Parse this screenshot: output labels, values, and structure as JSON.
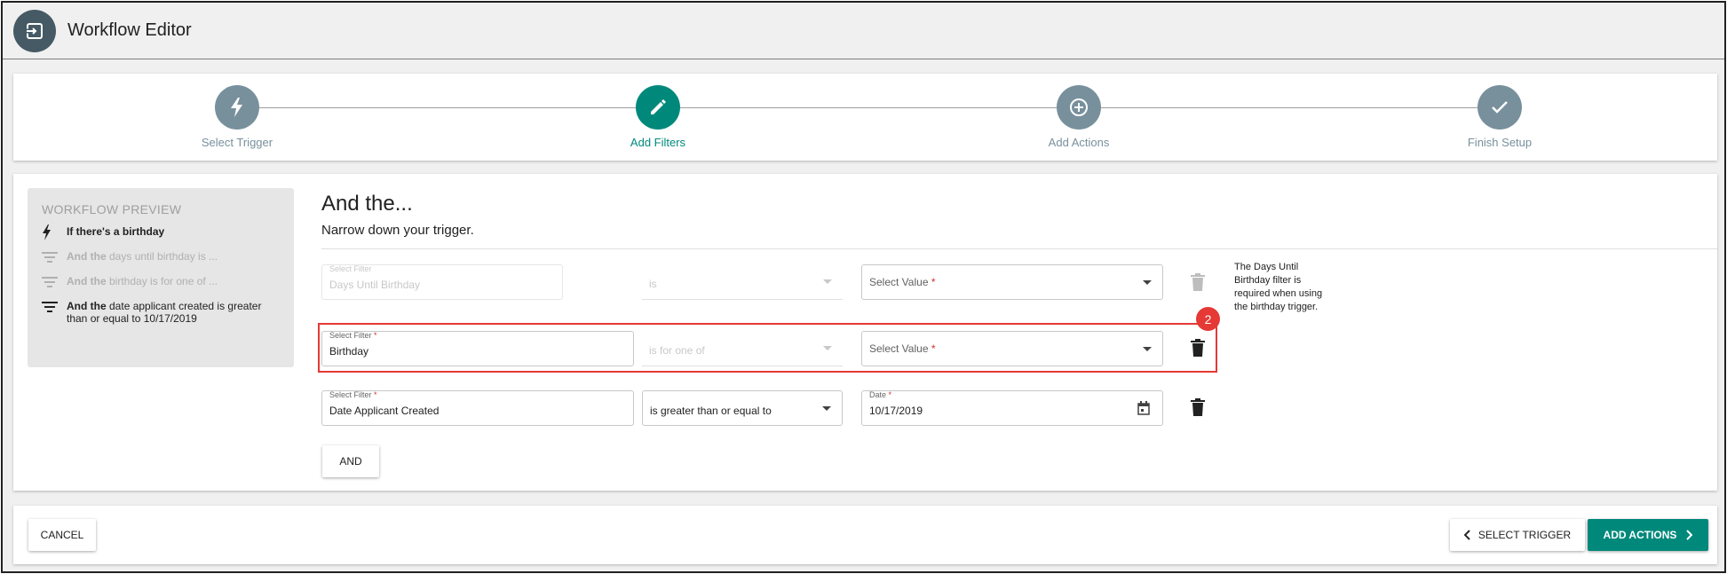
{
  "header": {
    "title": "Workflow Editor",
    "logo_icon": "exit-to-app-icon"
  },
  "stepper": {
    "steps": [
      {
        "label": "Select Trigger",
        "icon": "lightning-bolt-icon",
        "state": "completed"
      },
      {
        "label": "Add Filters",
        "icon": "pencil-icon",
        "state": "active"
      },
      {
        "label": "Add Actions",
        "icon": "plus-circle-icon",
        "state": "pending"
      },
      {
        "label": "Finish Setup",
        "icon": "check-icon",
        "state": "pending"
      }
    ]
  },
  "preview": {
    "title": "WORKFLOW PREVIEW",
    "items": [
      {
        "bold": "If there's a birthday",
        "rest": "",
        "icon": "lightning-bolt-icon",
        "muted": false
      },
      {
        "bold": "And the",
        "rest": " days until birthday is ...",
        "icon": "filter-list-icon",
        "muted": true
      },
      {
        "bold": "And the",
        "rest": " birthday is for one of ...",
        "icon": "filter-list-icon",
        "muted": true
      },
      {
        "bold": "And the",
        "rest": " date applicant created is greater than or equal to 10/17/2019",
        "icon": "filter-list-icon",
        "muted": false
      }
    ]
  },
  "filters": {
    "title": "And the...",
    "subtitle": "Narrow down your trigger.",
    "rows": [
      {
        "filter_label": "Select Filter",
        "filter_required": "",
        "filter_value": "Days Until Birthday",
        "operator_value": "is",
        "value_label": "",
        "value_placeholder": "Select Value",
        "value_required": "*"
      },
      {
        "filter_label": "Select Filter",
        "filter_required": "*",
        "filter_value": "Birthday",
        "operator_value": "is for one of",
        "value_label": "",
        "value_placeholder": "Select Value",
        "value_required": "*"
      },
      {
        "filter_label": "Select Filter",
        "filter_required": "*",
        "filter_value": "Date Applicant Created",
        "operator_value": "is greater than or equal to",
        "value_label": "Date",
        "value_required": "*",
        "value_value": "10/17/2019"
      }
    ],
    "helper_text": "The Days Until Birthday filter is required when using the birthday trigger.",
    "badge": "2",
    "and_button": "AND"
  },
  "footer": {
    "cancel": "CANCEL",
    "back": "SELECT TRIGGER",
    "next": "ADD ACTIONS"
  },
  "colors": {
    "accent": "#00897b",
    "step_inactive": "#78909c",
    "header_logo": "#455a64",
    "highlight": "#e53935"
  }
}
